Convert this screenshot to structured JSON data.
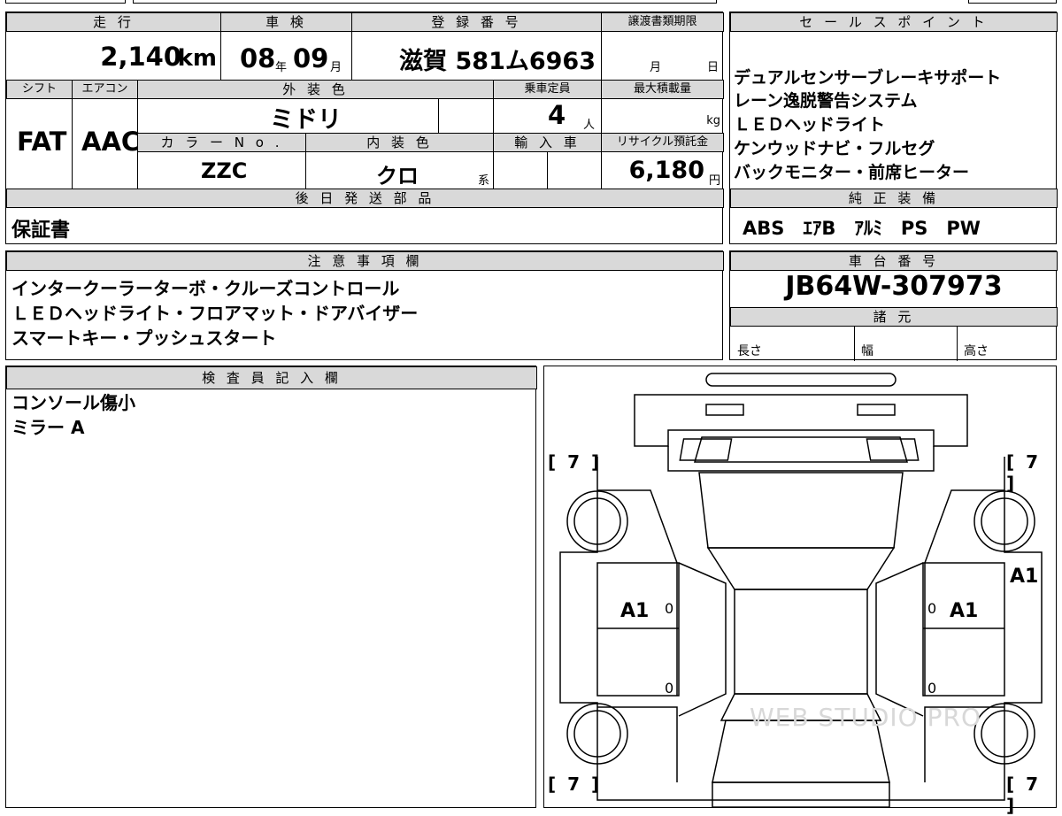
{
  "headers": {
    "mileage": "走 行",
    "inspection": "車 検",
    "registration": "登 録 番 号",
    "transfer_deadline": "譲渡書類期限",
    "sales_points": "セ ー ル ス ポ イ ン ト",
    "shift": "シフト",
    "aircon": "エアコン",
    "exterior_color": "外 装 色",
    "capacity": "乗車定員",
    "max_load": "最大積載量",
    "color_no": "カ ラ ー N o .",
    "interior_color": "内 装 色",
    "imported": "輸 入 車",
    "recycle_fee": "リサイクル預託金",
    "later_parts": "後 日 発 送 部 品",
    "genuine_equipment": "純 正 装 備",
    "notes": "注 意 事 項 欄",
    "chassis_number": "車 台 番 号",
    "specs": "諸 元",
    "inspector": "検 査 員 記 入 欄"
  },
  "values": {
    "mileage": "2,140",
    "mileage_unit": "km",
    "inspection_year": "08",
    "year_unit": "年",
    "inspection_month": "09",
    "month_unit": "月",
    "registration": "滋賀 581ム6963",
    "deadline_month_unit": "月",
    "deadline_day_unit": "日",
    "shift": "FAT",
    "aircon": "AAC",
    "exterior_color": "ミドリ",
    "capacity": "4",
    "capacity_unit": "人",
    "max_load_unit": "kg",
    "color_no": "ZZC",
    "interior_color": "クロ",
    "interior_suffix": "系",
    "recycle_fee": "6,180",
    "recycle_unit": "円",
    "later_parts": "保証書",
    "genuine_equipment": "ABS　ｴｱB　ｱﾙﾐ　PS　PW",
    "chassis_number": "JB64W-307973",
    "length_label": "長さ",
    "width_label": "幅",
    "height_label": "高さ"
  },
  "sales_points": [
    "デュアルセンサーブレーキサポート",
    "レーン逸脱警告システム",
    "ＬＥＤヘッドライト",
    "ケンウッドナビ・フルセグ",
    "バックモニター・前席ヒーター"
  ],
  "notes": [
    "インタークーラーターボ・クルーズコントロール",
    "ＬＥＤヘッドライト・フロアマット・ドアバイザー",
    "スマートキー・プッシュスタート"
  ],
  "inspector_notes": [
    "コンソール傷小",
    "ミラー A"
  ],
  "diagram": {
    "bracket_front_left": "[ 7 ]",
    "bracket_front_right": "[ 7 ]",
    "bracket_rear_left": "[ 7 ]",
    "bracket_rear_right": "[ 7 ]",
    "mark_left_door": "A1",
    "mark_right_door": "A1",
    "mark_right_side": "A1",
    "zero": "0",
    "watermark": "WEB STUDIO PRO"
  }
}
